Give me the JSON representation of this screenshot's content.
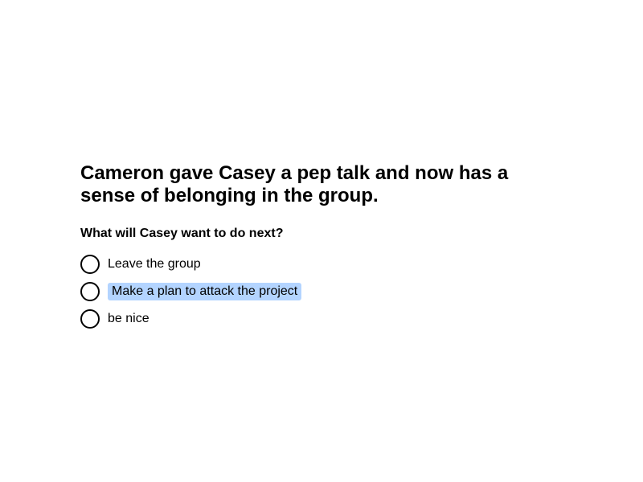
{
  "prompt": {
    "text": "Cameron gave Casey a pep talk and now has a sense of belonging in the group."
  },
  "question": {
    "text": "What will Casey want to do next?"
  },
  "options": [
    {
      "label": "Leave the group",
      "highlighted": false
    },
    {
      "label": "Make a plan to attack the project",
      "highlighted": true
    },
    {
      "label": "be nice",
      "highlighted": false
    }
  ],
  "colors": {
    "highlight": "#b3d4ff",
    "text": "#000000",
    "background": "#ffffff"
  }
}
